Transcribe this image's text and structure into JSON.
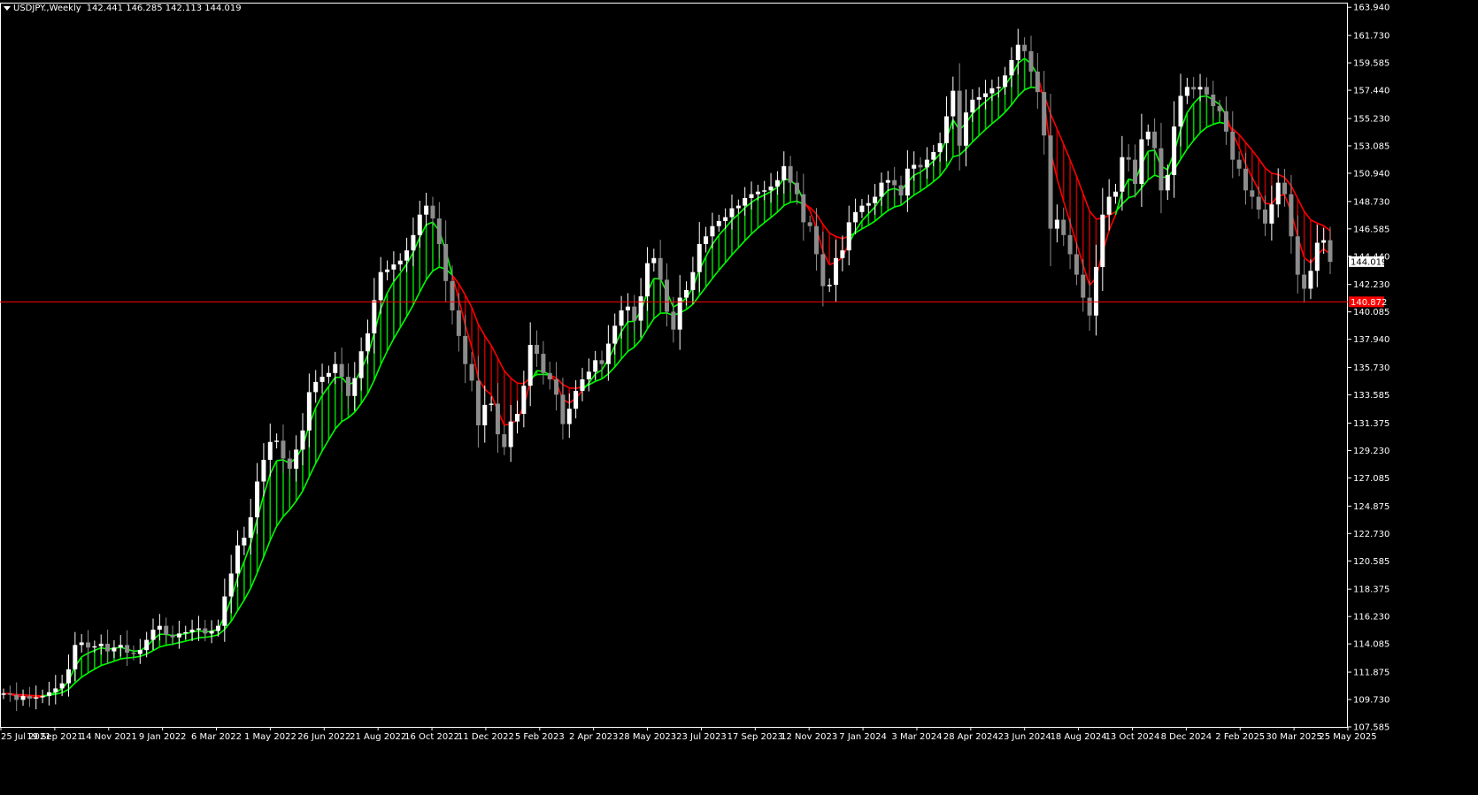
{
  "header": {
    "symbol": "USDJPY.,Weekly",
    "ohlc": "142.441 146.285 142.113 144.019"
  },
  "colors": {
    "background": "#000000",
    "axis": "#ffffff",
    "bull_candle": "#ffffff",
    "bear_candle": "#8c8c8c",
    "fast_ma": "#00ff00",
    "slow_ma_up": "#00ff00",
    "slow_ma_down": "#ff0000",
    "cloud_up": "#00c800",
    "cloud_down": "#b40000",
    "hline": "#ff0000",
    "price_label_bg": "#ffffff",
    "price_label_text": "#000000"
  },
  "chart_data": {
    "type": "candlestick",
    "symbol": "USDJPY.",
    "timeframe": "Weekly",
    "ylim": [
      107.585,
      164.3
    ],
    "y_ticks": [
      "163.940",
      "161.730",
      "159.585",
      "157.440",
      "155.230",
      "153.085",
      "150.940",
      "148.730",
      "146.585",
      "144.440",
      "142.230",
      "140.085",
      "137.940",
      "135.730",
      "133.585",
      "131.375",
      "129.230",
      "127.085",
      "124.875",
      "122.730",
      "120.585",
      "118.375",
      "116.230",
      "114.085",
      "111.875",
      "109.730",
      "107.585"
    ],
    "x_tick_labels": [
      "25 Jul 2021",
      "19 Sep 2021",
      "14 Nov 2021",
      "9 Jan 2022",
      "6 Mar 2022",
      "1 May 2022",
      "26 Jun 2022",
      "21 Aug 2022",
      "16 Oct 2022",
      "11 Dec 2022",
      "5 Feb 2023",
      "2 Apr 2023",
      "28 May 2023",
      "23 Jul 2023",
      "17 Sep 2023",
      "12 Nov 2023",
      "7 Jan 2024",
      "3 Mar 2024",
      "28 Apr 2024",
      "23 Jun 2024",
      "18 Aug 2024",
      "13 Oct 2024",
      "8 Dec 2024",
      "2 Feb 2025",
      "30 Mar 2025",
      "25 May 2025"
    ],
    "current_price": "144.019",
    "horizontal_line": {
      "value": 140.872,
      "label": "140.872"
    },
    "grid": false,
    "weekly_closes": [
      110.2,
      110.1,
      109.7,
      110.0,
      109.8,
      109.9,
      110.0,
      110.3,
      110.6,
      111.0,
      112.1,
      114.0,
      114.2,
      113.8,
      113.9,
      114.1,
      113.5,
      113.8,
      114.0,
      113.4,
      113.3,
      113.6,
      114.4,
      115.2,
      115.5,
      114.8,
      114.6,
      114.9,
      115.0,
      115.2,
      115.3,
      114.9,
      115.1,
      115.5,
      117.8,
      119.6,
      121.8,
      122.4,
      124.0,
      126.8,
      128.5,
      129.9,
      130.0,
      128.6,
      127.8,
      129.3,
      130.8,
      133.8,
      134.6,
      135.0,
      135.3,
      136.0,
      135.0,
      133.5,
      134.9,
      137.0,
      138.4,
      141.0,
      143.2,
      143.4,
      143.8,
      144.1,
      144.9,
      146.1,
      147.7,
      148.4,
      147.4,
      145.4,
      142.5,
      140.2,
      138.2,
      136.0,
      134.7,
      131.2,
      132.8,
      132.9,
      130.5,
      129.5,
      131.5,
      132.1,
      134.3,
      137.5,
      136.8,
      135.3,
      134.8,
      133.6,
      131.3,
      132.5,
      133.9,
      134.8,
      135.4,
      136.3,
      136.0,
      137.6,
      139.0,
      140.2,
      140.5,
      139.4,
      141.3,
      143.9,
      144.3,
      142.6,
      140.1,
      138.7,
      141.2,
      141.8,
      143.2,
      145.4,
      146.0,
      146.8,
      147.2,
      147.5,
      148.2,
      148.4,
      149.0,
      149.3,
      149.5,
      149.6,
      149.9,
      150.4,
      151.5,
      150.2,
      149.3,
      147.1,
      146.8,
      144.6,
      142.1,
      142.2,
      144.3,
      144.9,
      147.1,
      147.9,
      148.4,
      148.6,
      149.1,
      150.2,
      150.4,
      150.0,
      149.2,
      151.3,
      151.6,
      151.4,
      152.0,
      152.6,
      153.3,
      155.4,
      157.4,
      153.1,
      155.7,
      156.7,
      156.9,
      157.2,
      157.6,
      157.7,
      158.6,
      159.8,
      161.0,
      160.5,
      158.9,
      157.3,
      153.9,
      146.6,
      147.3,
      146.1,
      144.6,
      143.0,
      141.2,
      139.8,
      143.6,
      147.7,
      149.1,
      149.5,
      152.2,
      152.0,
      150.1,
      153.6,
      154.2,
      152.9,
      149.6,
      150.8,
      154.6,
      157.0,
      157.7,
      157.5,
      157.7,
      157.1,
      156.2,
      155.8,
      154.2,
      152.0,
      151.3,
      149.6,
      149.1,
      148.1,
      147.0,
      148.5,
      150.2,
      149.3,
      146.0,
      143.0,
      141.9,
      143.3,
      145.5,
      145.7,
      144.0
    ]
  }
}
